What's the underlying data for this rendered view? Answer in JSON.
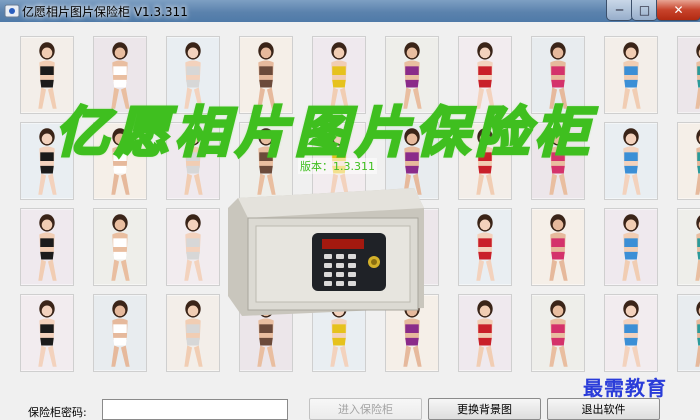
{
  "window": {
    "title": "亿愿相片图片保险柜 V1.3.311",
    "min_glyph": "─",
    "max_glyph": "□",
    "close_glyph": "✕"
  },
  "banner": {
    "text": "亿愿相片图片保险柜",
    "version": "版本：1.3.311"
  },
  "watermark": {
    "text": "最需教育"
  },
  "footer": {
    "password_label": "保险柜密码:",
    "enter_button": "进入保险柜",
    "change_bg_button": "更换背景图",
    "exit_button": "退出软件"
  },
  "colors": {
    "banner_stroke": "#3fbf1f",
    "watermark": "#2a3cd9",
    "close_button": "#c7432b"
  },
  "gallery": {
    "rows": 4,
    "columns": 10,
    "subject": "photo-thumbnail"
  }
}
